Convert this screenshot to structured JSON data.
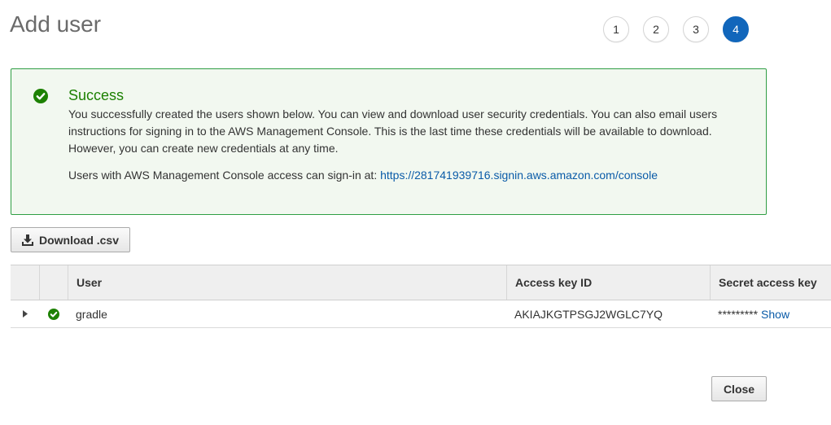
{
  "page": {
    "title": "Add user"
  },
  "steps": [
    "1",
    "2",
    "3",
    "4"
  ],
  "active_step": "4",
  "alert": {
    "title": "Success",
    "body": "You successfully created the users shown below. You can view and download user security credentials. You can also email users instructions for signing in to the AWS Management Console. This is the last time these credentials will be available to download. However, you can create new credentials at any time.",
    "signin_prefix": "Users with AWS Management Console access can sign-in at: ",
    "signin_url": "https://281741939716.signin.aws.amazon.com/console",
    "icon": "check-circle-icon"
  },
  "toolbar": {
    "download_label": "Download .csv",
    "download_icon": "download-icon"
  },
  "table": {
    "headers": {
      "user": "User",
      "access_key_id": "Access key ID",
      "secret_access_key": "Secret access key"
    },
    "rows": [
      {
        "user": "gradle",
        "access_key_id": "AKIAJKGTPSGJ2WGLC7YQ",
        "secret_masked": "*********",
        "secret_action": "Show",
        "status": "success"
      }
    ]
  },
  "footer": {
    "close_label": "Close"
  },
  "colors": {
    "accent": "#1166bb",
    "success": "#1d8102",
    "link": "#0a5ba8",
    "alert_bg": "#f2f8f0"
  }
}
